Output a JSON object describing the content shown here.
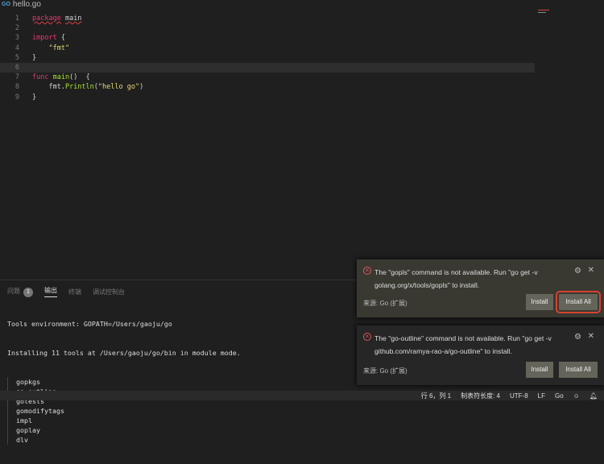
{
  "tab": {
    "title": "hello.go",
    "icon": "go-file-icon"
  },
  "editor": {
    "lines": [
      {
        "n": "1",
        "html": "<span class='kw sq'>package</span> <span class='sq'>main</span>"
      },
      {
        "n": "2",
        "html": ""
      },
      {
        "n": "3",
        "html": "<span class='kw'>import</span> {"
      },
      {
        "n": "4",
        "html": "    <span class='str'>\"fmt\"</span>"
      },
      {
        "n": "5",
        "html": "}"
      },
      {
        "n": "6",
        "html": ""
      },
      {
        "n": "7",
        "html": "<span class='kw'>func</span> <span class='fn'>main</span>()  {"
      },
      {
        "n": "8",
        "html": "    fmt.<span class='fn'>Println</span>(<span class='str'>\"hello go\"</span>)"
      },
      {
        "n": "9",
        "html": "}"
      }
    ],
    "current_line": 6
  },
  "panel": {
    "tabs": {
      "problems": "问题",
      "problems_count": "1",
      "output": "输出",
      "terminal": "终端",
      "debug_console": "调试控制台"
    },
    "output": [
      "Tools environment: GOPATH=/Users/gaoju/go",
      "Installing 11 tools at /Users/gaoju/go/bin in module mode."
    ],
    "tools": [
      "gopkgs",
      "go-outline",
      "gotests",
      "gomodifytags",
      "impl",
      "goplay",
      "dlv"
    ]
  },
  "notifications": [
    {
      "message": "The \"gopls\" command is not available. Run \"go get -v golang.org/x/tools/gopls\" to install.",
      "source": "来源: Go (扩展)",
      "install": "Install",
      "install_all": "Install All"
    },
    {
      "message": "The \"go-outline\" command is not available. Run \"go get -v github.com/ramya-rao-a/go-outline\" to install.",
      "source": "来源: Go (扩展)",
      "install": "Install",
      "install_all": "Install All"
    }
  ],
  "status": {
    "position": "行 6，列 1",
    "tab_size": "制表符长度: 4",
    "encoding": "UTF-8",
    "eol": "LF",
    "language": "Go"
  }
}
